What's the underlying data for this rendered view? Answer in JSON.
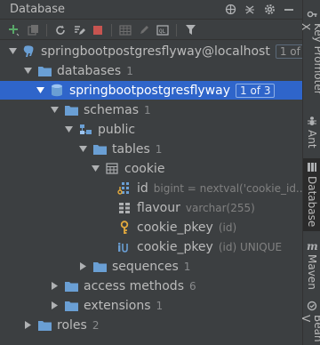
{
  "header": {
    "title": "Database"
  },
  "tree": {
    "rows": [
      {
        "label": "springbootpostgresflyway@localhost",
        "badge": "1 of 2"
      },
      {
        "label": "databases",
        "count": "1"
      },
      {
        "label": "springbootpostgresflyway",
        "badge": "1 of 3"
      },
      {
        "label": "schemas",
        "count": "1"
      },
      {
        "label": "public"
      },
      {
        "label": "tables",
        "count": "1"
      },
      {
        "label": "cookie"
      },
      {
        "label": "id",
        "detail": "bigint = nextval('cookie_id..."
      },
      {
        "label": "flavour",
        "detail": "varchar(255)"
      },
      {
        "label": "cookie_pkey",
        "detail": "(id)"
      },
      {
        "label": "cookie_pkey",
        "detail": "(id) UNIQUE"
      },
      {
        "label": "sequences",
        "count": "1"
      },
      {
        "label": "access methods",
        "count": "6"
      },
      {
        "label": "extensions",
        "count": "1"
      },
      {
        "label": "roles",
        "count": "2"
      }
    ]
  },
  "sidebar": {
    "tabs": [
      {
        "label": "Key Promoter X"
      },
      {
        "label": "Ant"
      },
      {
        "label": "Database"
      },
      {
        "label": "Maven"
      },
      {
        "label": "Bean V"
      }
    ]
  },
  "colors": {
    "selection": "#2f65ca",
    "folder": "#6a9fd4"
  }
}
